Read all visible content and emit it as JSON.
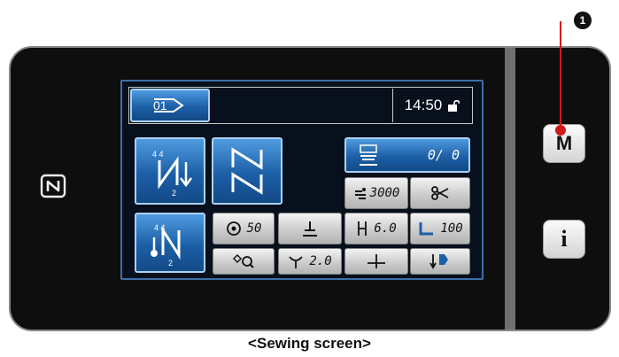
{
  "caption": "<Sewing screen>",
  "callout": {
    "number": "1"
  },
  "side_buttons": {
    "menu_label": "M",
    "info_label": "i"
  },
  "header": {
    "pattern_number": "01",
    "time": "14:50"
  },
  "counter": {
    "value": "0/ 0"
  },
  "speed": {
    "value": "3000"
  },
  "params": {
    "thread_tension": "50",
    "stitch_length": "6.0",
    "presser_pressure": "100",
    "needle_stroke": "2.0"
  },
  "colors": {
    "screen_bg": "#07101c",
    "button_blue": "#1c5fa7",
    "button_gray": "#c9c9c9",
    "callout": "#d01a1a"
  },
  "icons": [
    "nfc-icon",
    "pattern-icon",
    "unlock-icon",
    "counter-icon",
    "speed-icon",
    "scissors-icon",
    "thread-tension-icon",
    "presser-foot-icon",
    "stitch-length-icon",
    "presser-pressure-icon",
    "pattern-search-icon",
    "needle-icon",
    "reverse-stitch-icon",
    "feed-icon"
  ]
}
